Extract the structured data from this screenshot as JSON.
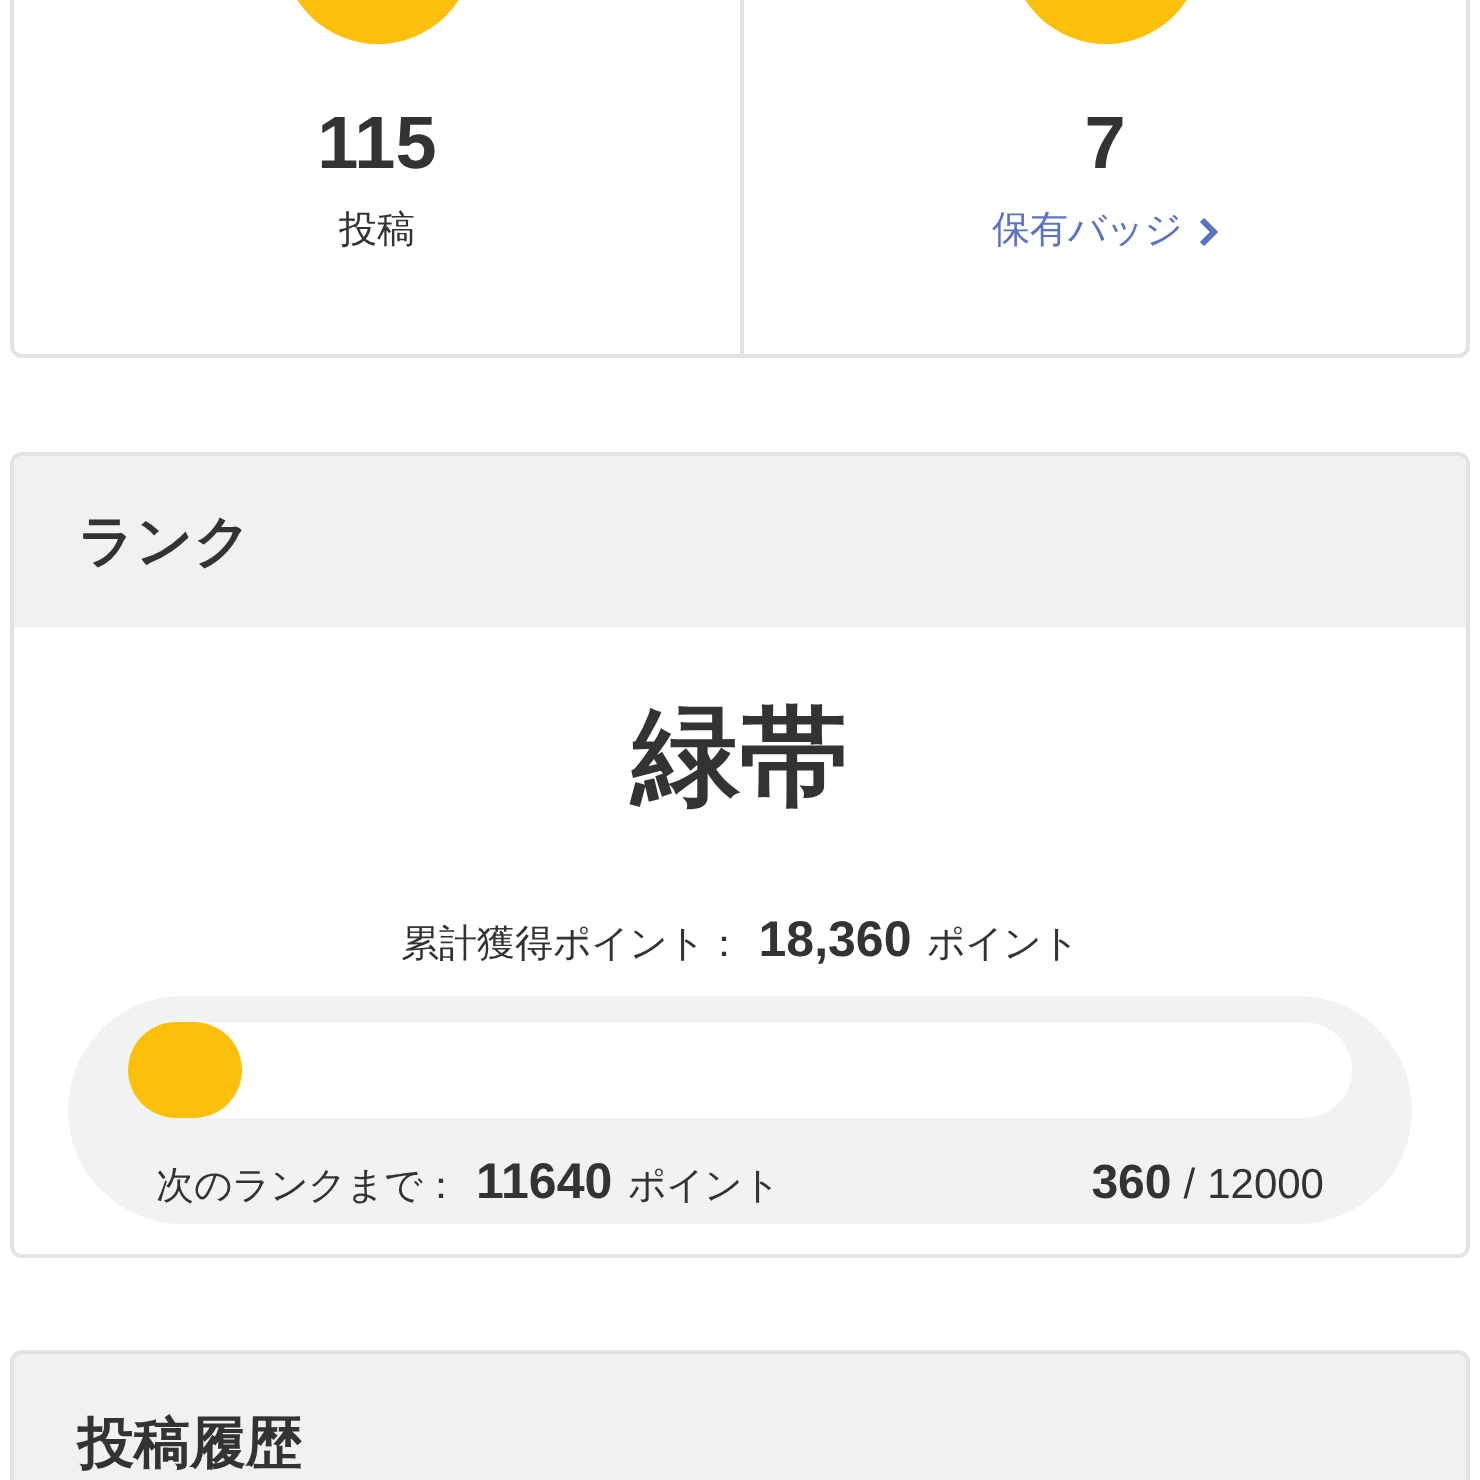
{
  "stats": [
    {
      "kind": "count",
      "value": "115",
      "label": "投稿"
    },
    {
      "kind": "link",
      "value": "7",
      "label": "保有バッジ"
    }
  ],
  "rank": {
    "title": "ランク",
    "name": "緑帯",
    "total_label": "累計獲得ポイント：",
    "total_value": "18,360",
    "total_unit": "ポイント",
    "next_label": "次のランクまで：",
    "next_value": "11640",
    "next_unit": "ポイント",
    "level": 0.03,
    "current": "360",
    "separator": "/",
    "goal": "12000"
  },
  "history": {
    "title": "投稿履歴"
  }
}
